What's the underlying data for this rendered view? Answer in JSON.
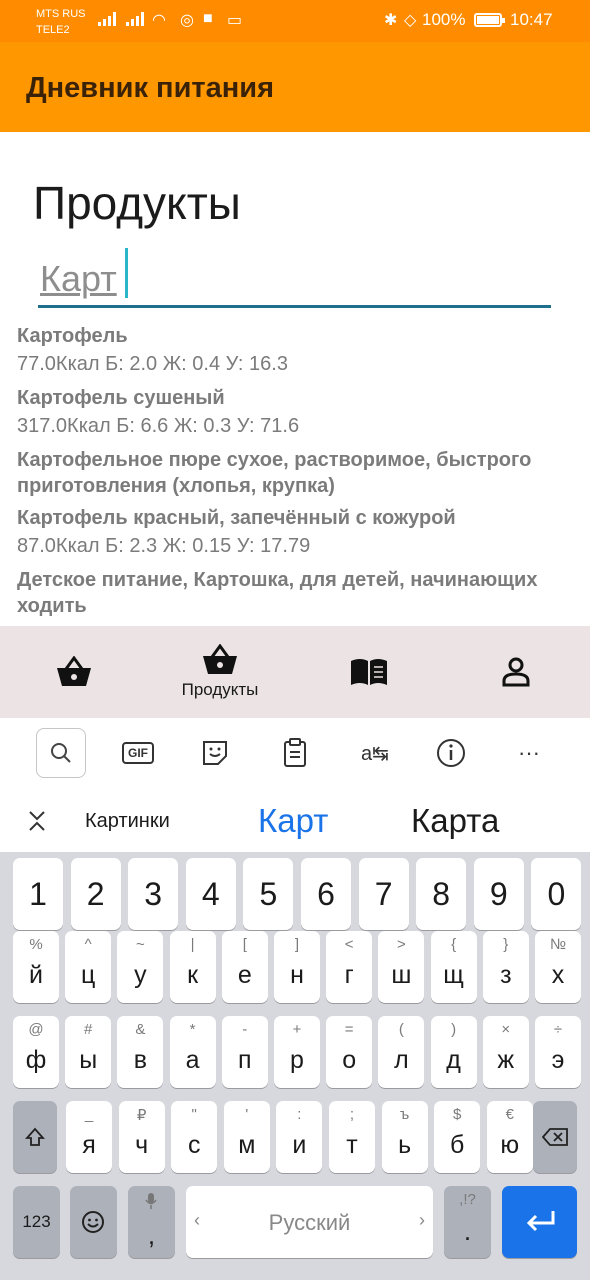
{
  "status_bar": {
    "carrier_1": "MTS RUS",
    "carrier_2": "TELE2",
    "battery": "100%",
    "time": "10:47"
  },
  "app_bar": {
    "title": "Дневник питания"
  },
  "page": {
    "title": "Продукты",
    "search_value": "Карт"
  },
  "results": [
    {
      "name": "Картофель",
      "nutrition": "77.0Ккал Б: 2.0 Ж: 0.4 У: 16.3"
    },
    {
      "name": "Картофель сушеный",
      "nutrition": "317.0Ккал Б: 6.6 Ж: 0.3 У: 71.6"
    },
    {
      "name": "Картофельное пюре сухое, растворимое, быстрого приготовления (хлопья, крупка)",
      "nutrition": ""
    },
    {
      "name": "Картофель красный, запечённый с кожурой",
      "nutrition": "87.0Ккал Б: 2.3 Ж: 0.15 У: 17.79"
    },
    {
      "name": "Детское питание, Картошка, для детей, начинающих ходить",
      "nutrition": ""
    }
  ],
  "bottom_nav": [
    {
      "icon": "basket-icon",
      "label": ""
    },
    {
      "icon": "basket-icon",
      "label": "Продукты"
    },
    {
      "icon": "book-icon",
      "label": ""
    },
    {
      "icon": "person-icon",
      "label": ""
    }
  ],
  "keyboard": {
    "toolbar": [
      "search-icon",
      "gif-icon",
      "sticker-icon",
      "clipboard-icon",
      "translate-icon",
      "info-icon",
      "more-icon"
    ],
    "gif_label": "GIF",
    "more_label": "···",
    "suggestions": [
      "Картинки",
      "Карт",
      "Карта"
    ],
    "accent": "#1a73e8",
    "number_row": [
      "1",
      "2",
      "3",
      "4",
      "5",
      "6",
      "7",
      "8",
      "9",
      "0"
    ],
    "row1": [
      {
        "main": "й",
        "sub": "%"
      },
      {
        "main": "ц",
        "sub": "^"
      },
      {
        "main": "у",
        "sub": "~"
      },
      {
        "main": "к",
        "sub": "|"
      },
      {
        "main": "е",
        "sub": "["
      },
      {
        "main": "н",
        "sub": "]"
      },
      {
        "main": "г",
        "sub": "<"
      },
      {
        "main": "ш",
        "sub": ">"
      },
      {
        "main": "щ",
        "sub": "{"
      },
      {
        "main": "з",
        "sub": "}"
      },
      {
        "main": "х",
        "sub": "№"
      }
    ],
    "row2": [
      {
        "main": "ф",
        "sub": "@"
      },
      {
        "main": "ы",
        "sub": "#"
      },
      {
        "main": "в",
        "sub": "&"
      },
      {
        "main": "а",
        "sub": "*"
      },
      {
        "main": "п",
        "sub": "-"
      },
      {
        "main": "р",
        "sub": "+"
      },
      {
        "main": "о",
        "sub": "="
      },
      {
        "main": "л",
        "sub": "("
      },
      {
        "main": "д",
        "sub": ")"
      },
      {
        "main": "ж",
        "sub": "×"
      },
      {
        "main": "э",
        "sub": "÷"
      }
    ],
    "row3": [
      {
        "main": "я",
        "sub": "_"
      },
      {
        "main": "ч",
        "sub": "₽"
      },
      {
        "main": "с",
        "sub": "\""
      },
      {
        "main": "м",
        "sub": "'"
      },
      {
        "main": "и",
        "sub": ":"
      },
      {
        "main": "т",
        "sub": ";"
      },
      {
        "main": "ь",
        "sub": "ъ"
      },
      {
        "main": "б",
        "sub": "$"
      },
      {
        "main": "ю",
        "sub": "€"
      }
    ],
    "num_switch": "123",
    "comma_key": ",",
    "space_label": "Русский",
    "period_key": ".",
    "period_sub": ",!?"
  }
}
